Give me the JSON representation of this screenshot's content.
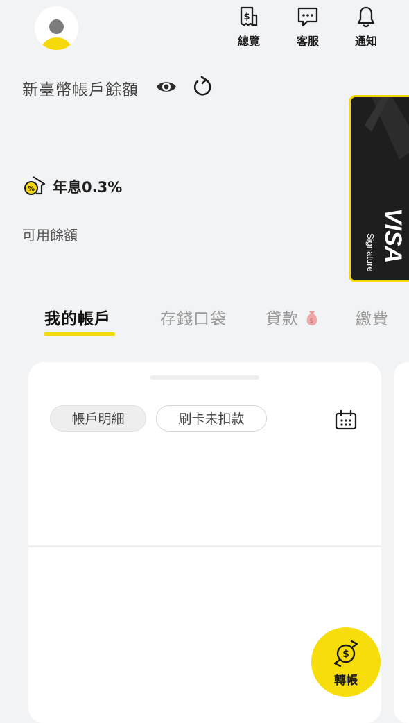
{
  "header": {
    "avatar_icon": "user-avatar-icon",
    "nav": [
      {
        "label": "總覽",
        "icon": "bill-dollar-icon"
      },
      {
        "label": "客服",
        "icon": "chat-bubble-icon"
      },
      {
        "label": "通知",
        "icon": "bell-icon"
      }
    ]
  },
  "balance": {
    "title": "新臺幣帳戶餘額",
    "eye_icon": "eye-icon",
    "refresh_icon": "refresh-icon",
    "interest_rate": "年息0.3%",
    "interest_icon": "percent-tag-icon",
    "available_label": "可用餘額"
  },
  "card": {
    "brand": "VISA",
    "tier": "Signature",
    "border_color": "#f5d90a"
  },
  "tabs": [
    {
      "label": "我的帳戶",
      "active": true
    },
    {
      "label": "存錢口袋",
      "active": false
    },
    {
      "label": "貸款",
      "active": false,
      "icon": "money-bag-icon"
    },
    {
      "label": "繳費",
      "active": false
    }
  ],
  "panel": {
    "chips": [
      {
        "label": "帳戶明細",
        "active": true
      },
      {
        "label": "刷卡未扣款",
        "active": false
      }
    ],
    "calendar_icon": "calendar-icon"
  },
  "fab": {
    "label": "轉帳",
    "icon": "transfer-dollar-icon"
  },
  "colors": {
    "accent": "#f5d90a",
    "background": "#f2f3f5"
  }
}
